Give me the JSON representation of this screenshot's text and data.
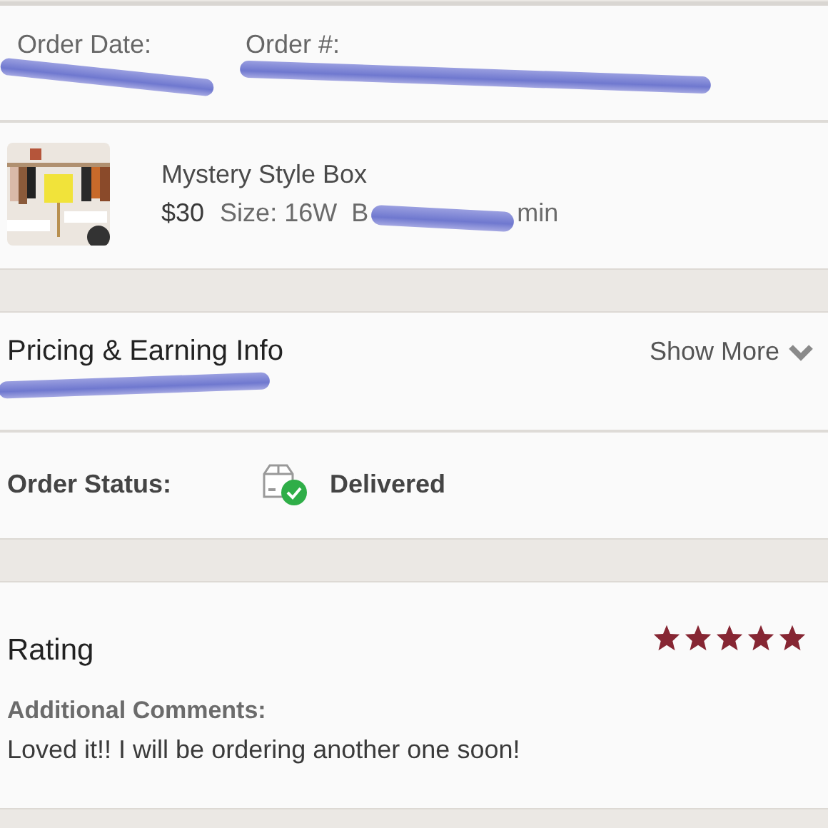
{
  "order_info": {
    "date_label": "Order Date:",
    "number_label": "Order #:"
  },
  "item": {
    "title": "Mystery Style Box",
    "price": "$30",
    "size": "Size: 16W",
    "buyer_start": "B",
    "buyer_end": "min"
  },
  "pricing": {
    "title": "Pricing & Earning Info",
    "toggle": "Show More",
    "expanded": false
  },
  "order_status": {
    "label": "Order Status:",
    "value": "Delivered"
  },
  "rating": {
    "title": "Rating",
    "stars": 5,
    "comments_label": "Additional Comments:",
    "comment": "Loved it!! I will be ordering another one soon!"
  }
}
